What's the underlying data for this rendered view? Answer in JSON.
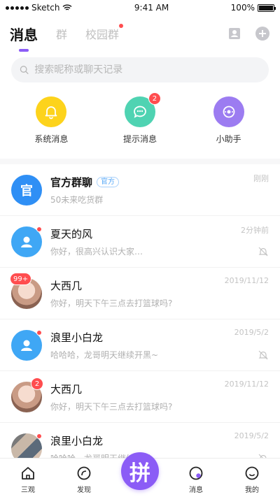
{
  "status_bar": {
    "carrier": "Sketch",
    "time": "9:41 AM",
    "battery": "100%"
  },
  "tabs": [
    {
      "label": "消息",
      "active": true
    },
    {
      "label": "群"
    },
    {
      "label": "校园群"
    }
  ],
  "search": {
    "placeholder": "搜索昵称或聊天记录"
  },
  "quick_actions": [
    {
      "label": "系统消息",
      "icon": "bell-icon",
      "color": "#fdd31c"
    },
    {
      "label": "提示消息",
      "icon": "chat-icon",
      "color": "#4fd3b2",
      "badge": "2"
    },
    {
      "label": "小助手",
      "icon": "assistant-icon",
      "color": "#9c7cf1"
    }
  ],
  "conversations": [
    {
      "name": "官方群聊",
      "tag": "官方",
      "preview": "50未来吃货群",
      "time": "刚刚",
      "avatar_text": "官",
      "avatar_color": "#2f8ff5"
    },
    {
      "name": "夏天的风",
      "preview": "你好，很高兴认识大家…",
      "time": "2分钟前",
      "muted": true,
      "dot": true,
      "avatar_color": "#3fa7f5"
    },
    {
      "name": "大西几",
      "preview": "你好，明天下午三点去打篮球吗?",
      "time": "2019/11/12",
      "badge": "99+",
      "avatar_color": "#e8c0b0"
    },
    {
      "name": "浪里小白龙",
      "preview": "哈哈哈，龙哥明天继续开黑~",
      "time": "2019/5/2",
      "muted": true,
      "dot": true,
      "avatar_color": "#3fa7f5"
    },
    {
      "name": "大西几",
      "preview": "你好，明天下午三点去打篮球吗?",
      "time": "2019/11/12",
      "badge": "2",
      "avatar_color": "#e8c0b0"
    },
    {
      "name": "浪里小白龙",
      "preview": "哈哈哈，龙哥明天继续开黑~",
      "time": "2019/5/2",
      "muted": true,
      "dot": true,
      "avatar_color": "#b5b0aa"
    }
  ],
  "bottom_nav": [
    {
      "label": "三观",
      "icon": "home-icon"
    },
    {
      "label": "发现",
      "icon": "discover-icon"
    },
    {
      "label": "拼",
      "icon": "center-pin"
    },
    {
      "label": "消息",
      "icon": "message-icon",
      "active": true
    },
    {
      "label": "我的",
      "icon": "profile-icon"
    }
  ],
  "colors": {
    "accent": "#8b5cf6",
    "badge": "#ff4d4f"
  }
}
